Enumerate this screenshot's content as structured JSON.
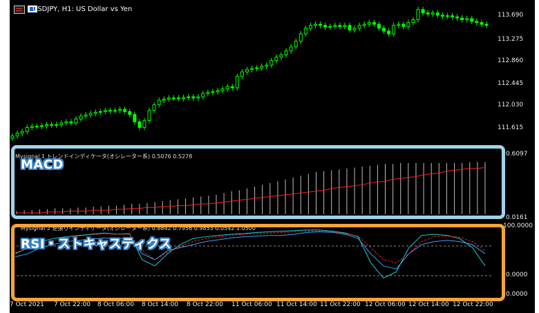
{
  "header": {
    "title": "USDJPY, H1:  US Dollar vs Yen",
    "icons": [
      "chart-properties-icon",
      "one-click-trading-icon"
    ]
  },
  "price_axis": [
    "113.690",
    "113.275",
    "112.860",
    "112.445",
    "112.030",
    "111.615"
  ],
  "macd_pane": {
    "label": "Mysignal 1 トレンドインディケータ(オシレーター系) 0.5076 0.5278",
    "axis_top": "0.6097",
    "axis_bottom": "0.0161",
    "callout": "MACD"
  },
  "rsi_pane": {
    "label": "Mysignal 2 逆張りインディケータ(オシレーター系) 0.8842 0.7956 0.9853 0.0542 1.0500",
    "axis_top": "100.0000",
    "axis_mid": "0.0000",
    "axis_bottom": "0.0000",
    "callout": "RSI・ストキャスティクス"
  },
  "time_axis": [
    "7 Oct 2021",
    "7 Oct 22:00",
    "8 Oct 06:00",
    "8 Oct 14:00",
    "8 Oct 22:00",
    "11 Oct 06:00",
    "11 Oct 14:00",
    "11 Oct 22:00",
    "12 Oct 06:00",
    "12 Oct 14:00",
    "12 Oct 22:00"
  ],
  "colors": {
    "background": "#000000",
    "candle": "#00ff00",
    "histogram": "#c0c0c0",
    "signal": "#ff2020",
    "rsi_line": "#3aa0ff",
    "stoch_main": "#20d0d0",
    "stoch_signal": "#ff2020",
    "macd_callout_border": "#9fd3ea",
    "rsi_callout_border": "#f5a43a"
  },
  "chart_data": [
    {
      "type": "candlestick",
      "title": "USDJPY, H1:  US Dollar vs Yen",
      "ylim": [
        111.45,
        113.85
      ],
      "close": [
        111.55,
        111.6,
        111.63,
        111.7,
        111.72,
        111.72,
        111.73,
        111.75,
        111.74,
        111.75,
        111.78,
        111.8,
        111.78,
        111.85,
        111.9,
        111.92,
        111.95,
        111.97,
        111.98,
        112.0,
        111.99,
        112.0,
        112.02,
        111.98,
        111.93,
        111.8,
        111.7,
        111.82,
        112.0,
        112.1,
        112.18,
        112.2,
        112.22,
        112.22,
        112.21,
        112.23,
        112.24,
        112.22,
        112.24,
        112.3,
        112.32,
        112.33,
        112.35,
        112.38,
        112.42,
        112.4,
        112.6,
        112.68,
        112.72,
        112.74,
        112.75,
        112.78,
        112.8,
        112.88,
        112.94,
        112.98,
        113.05,
        113.12,
        113.22,
        113.35,
        113.45,
        113.5,
        113.52,
        113.5,
        113.47,
        113.48,
        113.5,
        113.48,
        113.5,
        113.42,
        113.45,
        113.5,
        113.52,
        113.55,
        113.52,
        113.45,
        113.4,
        113.35,
        113.5,
        113.52,
        113.48,
        113.55,
        113.6,
        113.78,
        113.72,
        113.7,
        113.72,
        113.68,
        113.66,
        113.67,
        113.65,
        113.63,
        113.6,
        113.62,
        113.57,
        113.55,
        113.52,
        113.5
      ]
    },
    {
      "type": "bar",
      "title": "Mysignal 1 トレンドインディケータ(オシレーター系)",
      "ylim": [
        0.0161,
        0.6097
      ],
      "histogram": [
        0.05,
        0.06,
        0.06,
        0.07,
        0.07,
        0.08,
        0.08,
        0.08,
        0.09,
        0.09,
        0.1,
        0.1,
        0.11,
        0.11,
        0.12,
        0.13,
        0.13,
        0.14,
        0.15,
        0.16,
        0.17,
        0.18,
        0.19,
        0.2,
        0.21,
        0.22,
        0.23,
        0.25,
        0.27,
        0.28,
        0.3,
        0.32,
        0.34,
        0.36,
        0.38,
        0.4,
        0.42,
        0.44,
        0.46,
        0.48,
        0.49,
        0.5,
        0.51,
        0.52,
        0.53,
        0.54,
        0.55,
        0.56,
        0.57,
        0.57,
        0.58,
        0.58,
        0.58,
        0.58,
        0.58,
        0.58,
        0.58,
        0.58,
        0.58,
        0.59,
        0.59,
        0.59
      ],
      "signal": [
        0.03,
        0.03,
        0.03,
        0.03,
        0.04,
        0.04,
        0.04,
        0.05,
        0.05,
        0.05,
        0.06,
        0.06,
        0.06,
        0.07,
        0.07,
        0.08,
        0.08,
        0.09,
        0.09,
        0.1,
        0.1,
        0.11,
        0.11,
        0.12,
        0.13,
        0.13,
        0.14,
        0.15,
        0.16,
        0.17,
        0.18,
        0.19,
        0.2,
        0.21,
        0.22,
        0.23,
        0.24,
        0.25,
        0.26,
        0.27,
        0.28,
        0.3,
        0.31,
        0.32,
        0.33,
        0.34,
        0.36,
        0.37,
        0.38,
        0.4,
        0.41,
        0.42,
        0.43,
        0.45,
        0.46,
        0.47,
        0.49,
        0.5,
        0.51,
        0.52,
        0.52,
        0.53
      ]
    },
    {
      "type": "line",
      "title": "Mysignal 2 逆張りインディケータ(オシレーター系)",
      "ylim": [
        0,
        100
      ],
      "series": [
        {
          "values": [
            55,
            60,
            70,
            75,
            80,
            82,
            84,
            86,
            85,
            85,
            60,
            50,
            65,
            70,
            75,
            80,
            83,
            86,
            88,
            89,
            90,
            90,
            92,
            95,
            96,
            95,
            92,
            85,
            60,
            40,
            35,
            60,
            75,
            80,
            82,
            80,
            75,
            60
          ]
        },
        {
          "values": [
            60,
            70,
            80,
            85,
            88,
            90,
            92,
            94,
            92,
            93,
            50,
            40,
            60,
            75,
            85,
            88,
            90,
            92,
            93,
            95,
            96,
            97,
            98,
            99,
            99,
            97,
            94,
            88,
            45,
            20,
            30,
            70,
            90,
            92,
            90,
            85,
            70,
            40
          ]
        },
        {
          "values": [
            62,
            68,
            76,
            82,
            86,
            89,
            91,
            93,
            92,
            92,
            65,
            50,
            62,
            72,
            80,
            85,
            88,
            90,
            92,
            93,
            94,
            95,
            96,
            97,
            97,
            96,
            93,
            89,
            70,
            50,
            45,
            60,
            80,
            88,
            89,
            87,
            80,
            65
          ]
        }
      ]
    }
  ]
}
